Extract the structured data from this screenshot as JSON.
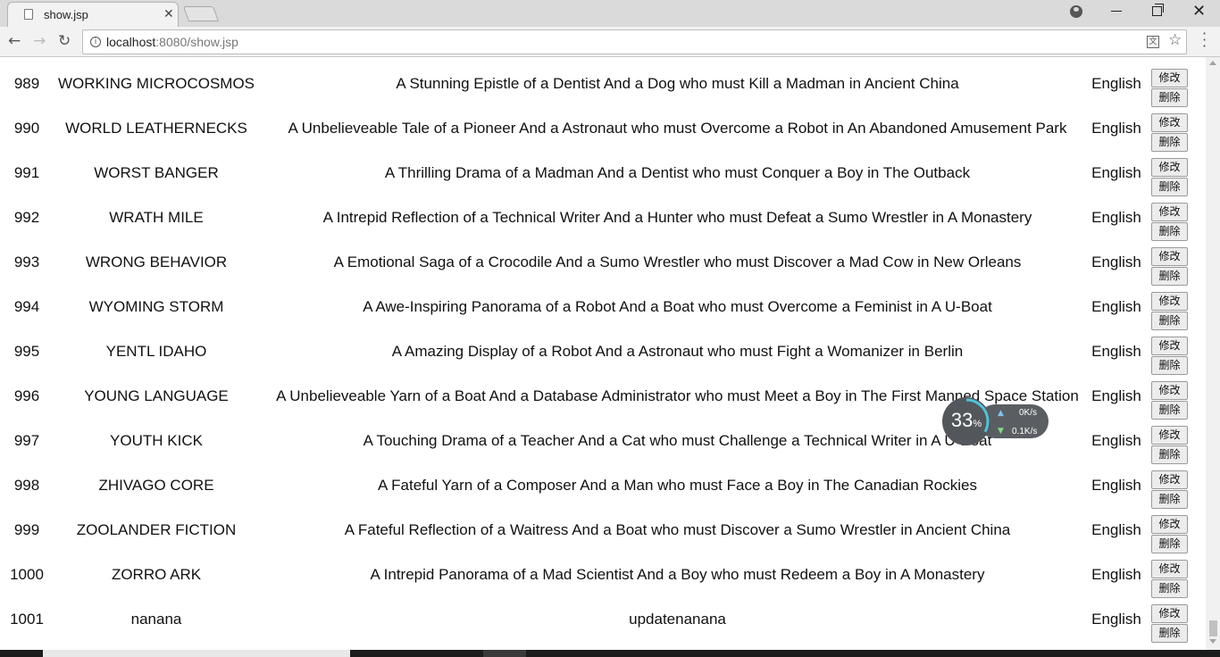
{
  "browser": {
    "tab_title": "show.jsp",
    "tab_close": "✕",
    "url_host": "localhost",
    "url_path": ":8080/show.jsp"
  },
  "table": {
    "edit_label": "修改",
    "delete_label": "删除",
    "rows": [
      {
        "id": "989",
        "title": "WORKING MICROCOSMOS",
        "description": "A Stunning Epistle of a Dentist And a Dog who must Kill a Madman in Ancient China",
        "language": "English"
      },
      {
        "id": "990",
        "title": "WORLD LEATHERNECKS",
        "description": "A Unbelieveable Tale of a Pioneer And a Astronaut who must Overcome a Robot in An Abandoned Amusement Park",
        "language": "English"
      },
      {
        "id": "991",
        "title": "WORST BANGER",
        "description": "A Thrilling Drama of a Madman And a Dentist who must Conquer a Boy in The Outback",
        "language": "English"
      },
      {
        "id": "992",
        "title": "WRATH MILE",
        "description": "A Intrepid Reflection of a Technical Writer And a Hunter who must Defeat a Sumo Wrestler in A Monastery",
        "language": "English"
      },
      {
        "id": "993",
        "title": "WRONG BEHAVIOR",
        "description": "A Emotional Saga of a Crocodile And a Sumo Wrestler who must Discover a Mad Cow in New Orleans",
        "language": "English"
      },
      {
        "id": "994",
        "title": "WYOMING STORM",
        "description": "A Awe-Inspiring Panorama of a Robot And a Boat who must Overcome a Feminist in A U-Boat",
        "language": "English"
      },
      {
        "id": "995",
        "title": "YENTL IDAHO",
        "description": "A Amazing Display of a Robot And a Astronaut who must Fight a Womanizer in Berlin",
        "language": "English"
      },
      {
        "id": "996",
        "title": "YOUNG LANGUAGE",
        "description": "A Unbelieveable Yarn of a Boat And a Database Administrator who must Meet a Boy in The First Manned Space Station",
        "language": "English"
      },
      {
        "id": "997",
        "title": "YOUTH KICK",
        "description": "A Touching Drama of a Teacher And a Cat who must Challenge a Technical Writer in A U-Boat",
        "language": "English"
      },
      {
        "id": "998",
        "title": "ZHIVAGO CORE",
        "description": "A Fateful Yarn of a Composer And a Man who must Face a Boy in The Canadian Rockies",
        "language": "English"
      },
      {
        "id": "999",
        "title": "ZOOLANDER FICTION",
        "description": "A Fateful Reflection of a Waitress And a Boat who must Discover a Sumo Wrestler in Ancient China",
        "language": "English"
      },
      {
        "id": "1000",
        "title": "ZORRO ARK",
        "description": "A Intrepid Panorama of a Mad Scientist And a Boy who must Redeem a Boy in A Monastery",
        "language": "English"
      },
      {
        "id": "1001",
        "title": "nanana",
        "description": "updatenanana",
        "language": "English"
      }
    ]
  },
  "net_widget": {
    "percent": "33",
    "percent_unit": "%",
    "upload": "0K/s",
    "download": "0.1K/s",
    "load_fraction": 0.33,
    "ring_color": "#4fc3d9"
  }
}
